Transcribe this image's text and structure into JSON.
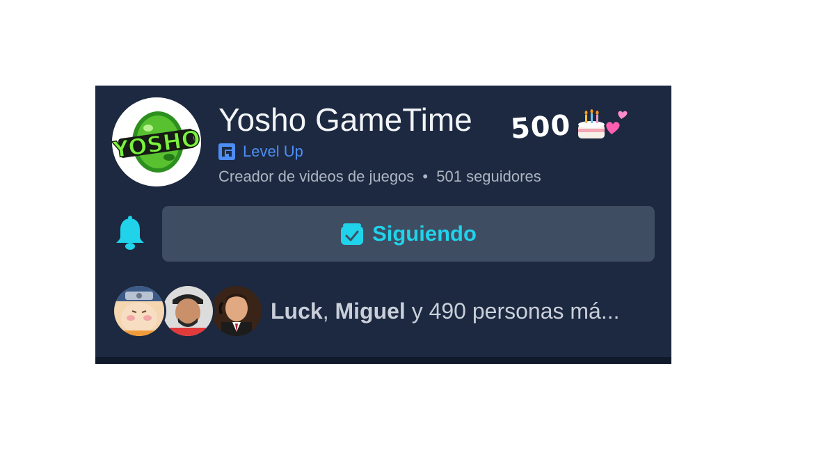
{
  "profile": {
    "name": "Yosho GameTime",
    "logo_text": "YOSHO",
    "badge_label": "Level Up",
    "category": "Creador de videos de juegos",
    "separator": "•",
    "followers": "501 seguidores",
    "overlay_number": "500",
    "overlay_emojis": "🎂💕"
  },
  "actions": {
    "follow_label": "Siguiendo",
    "bell_icon": "bell-icon"
  },
  "friends": {
    "name1": "Luck",
    "comma": ",",
    "name2": "Miguel",
    "rest": "y 490 personas má..."
  },
  "colors": {
    "card_bg": "#1c2940",
    "button_bg": "#3f4d62",
    "accent": "#20d3ea",
    "badge_blue": "#4d8ef5"
  }
}
